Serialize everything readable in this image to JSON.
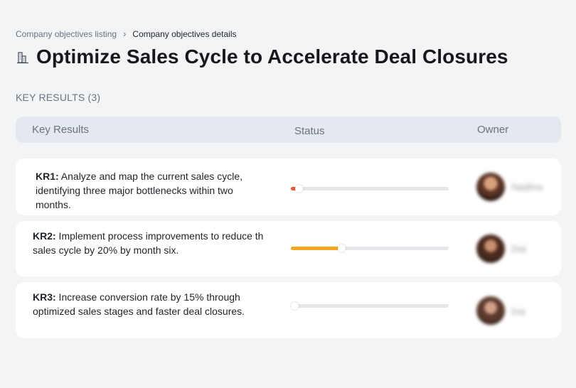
{
  "breadcrumb": {
    "parent": "Company objectives listing",
    "separator": "›",
    "current": "Company objectives details"
  },
  "page": {
    "title": "Optimize Sales Cycle to Accelerate Deal Closures",
    "title_icon": "building-icon"
  },
  "key_results_section": {
    "label": "KEY RESULTS (3)"
  },
  "table": {
    "headers": {
      "key_results": "Key Results",
      "status": "Status",
      "owner": "Owner"
    }
  },
  "key_results": [
    {
      "id": "KR1:",
      "text": " Analyze and map the current sales cycle, identifying three major bottlenecks within two months.",
      "progress": 0.05,
      "progress_color": "#ee5a2f",
      "owner": "Nadine"
    },
    {
      "id": "KR2:",
      "text": " Implement process improvements to reduce th sales cycle by 20% by month six.",
      "progress": 0.32,
      "progress_color": "#f5a623",
      "owner": "Dai"
    },
    {
      "id": "KR3:",
      "text": " Increase conversion rate by 15% through optimized sales stages and faster deal closures.",
      "progress": 0.02,
      "progress_color": "#ee5a2f",
      "owner": "Ina"
    }
  ]
}
